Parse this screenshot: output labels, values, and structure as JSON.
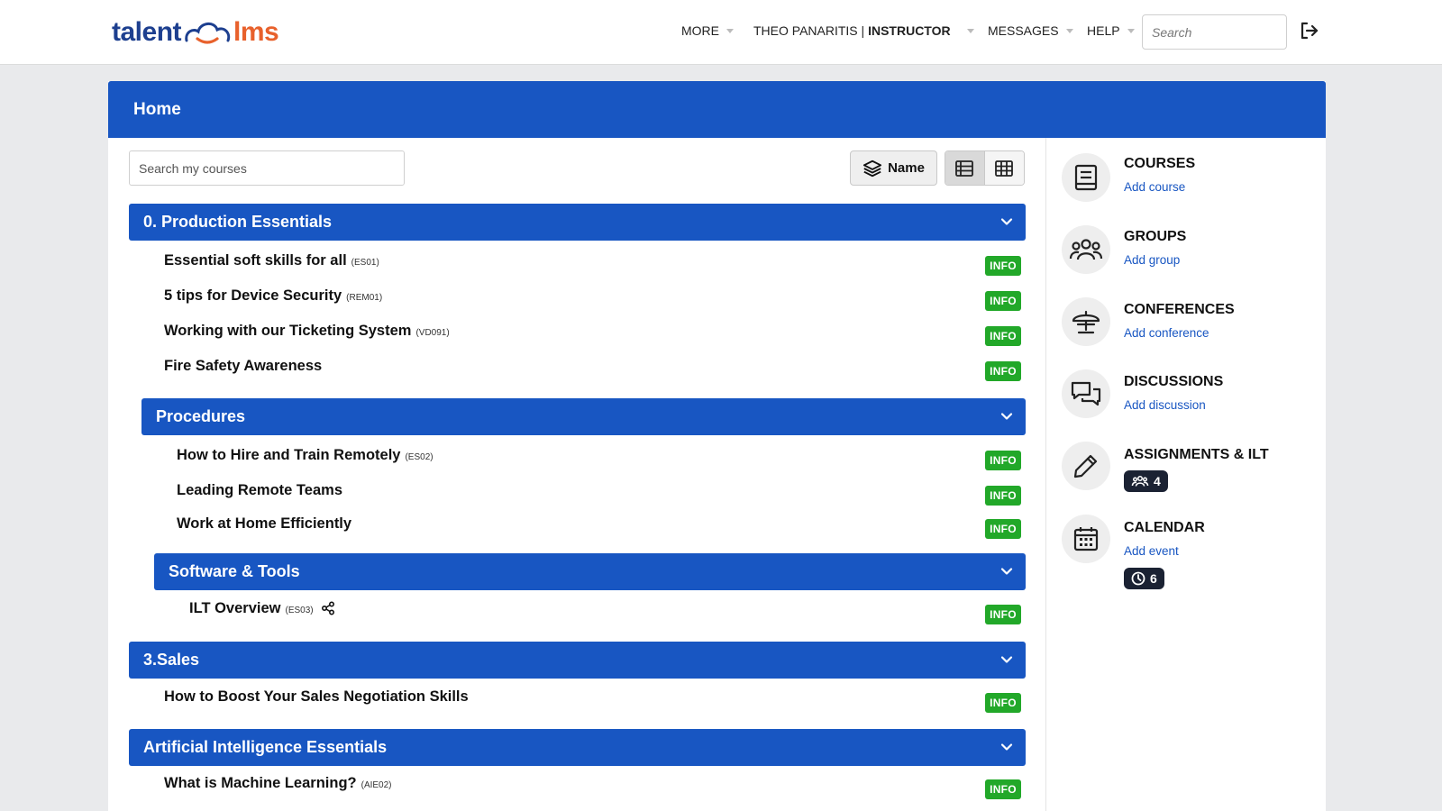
{
  "brand": {
    "part1": "talent",
    "part2": "lms",
    "icon": "cloud-icon"
  },
  "nav": {
    "more": "MORE",
    "user_name": "THEO PANARITIS",
    "separator": "|",
    "role": "INSTRUCTOR",
    "messages": "MESSAGES",
    "help": "HELP"
  },
  "top_search": {
    "placeholder": "Search"
  },
  "page": {
    "title": "Home"
  },
  "course_search": {
    "placeholder": "Search my courses"
  },
  "sort": {
    "label": "Name",
    "icon": "layers-icon"
  },
  "view_toggle": {
    "list_icon": "list-view-icon",
    "grid_icon": "grid-view-icon",
    "active": "list"
  },
  "categories": [
    {
      "name": "0. Production Essentials"
    },
    {
      "name": "Procedures"
    },
    {
      "name": "Software & Tools"
    },
    {
      "name": "3.Sales"
    },
    {
      "name": "Artificial Intelligence Essentials"
    }
  ],
  "courses": [
    {
      "title": "Essential soft skills for all",
      "code": "(ES01)"
    },
    {
      "title": "5 tips for Device Security",
      "code": "(REM01)"
    },
    {
      "title": "Working with our Ticketing System",
      "code": "(VD091)"
    },
    {
      "title": "Fire Safety Awareness",
      "code": ""
    },
    {
      "title": "How to Hire and Train Remotely",
      "code": "(ES02)"
    },
    {
      "title": "Leading Remote Teams",
      "code": ""
    },
    {
      "title": "Work at Home Efficiently",
      "code": ""
    },
    {
      "title": "ILT Overview",
      "code": "(ES03)"
    },
    {
      "title": "How to Boost Your Sales Negotiation Skills",
      "code": ""
    },
    {
      "title": "What is Machine Learning?",
      "code": "(AIE02)"
    }
  ],
  "info_label": "INFO",
  "sidebar": {
    "courses": {
      "title": "COURSES",
      "link": "Add course",
      "icon": "book-icon"
    },
    "groups": {
      "title": "GROUPS",
      "link": "Add group",
      "icon": "users-icon"
    },
    "conferences": {
      "title": "CONFERENCES",
      "link": "Add conference",
      "icon": "conference-icon"
    },
    "discussions": {
      "title": "DISCUSSIONS",
      "link": "Add discussion",
      "icon": "chat-icon"
    },
    "assignments": {
      "title": "ASSIGNMENTS & ILT",
      "count": "4",
      "icon": "pencil-icon"
    },
    "calendar": {
      "title": "CALENDAR",
      "link": "Add event",
      "count": "6",
      "icon": "calendar-icon"
    }
  },
  "colors": {
    "primary": "#1856c2",
    "info": "#22a829",
    "brand_blue": "#1d3f8f",
    "brand_orange": "#e8612c",
    "pill": "#1b2233"
  }
}
